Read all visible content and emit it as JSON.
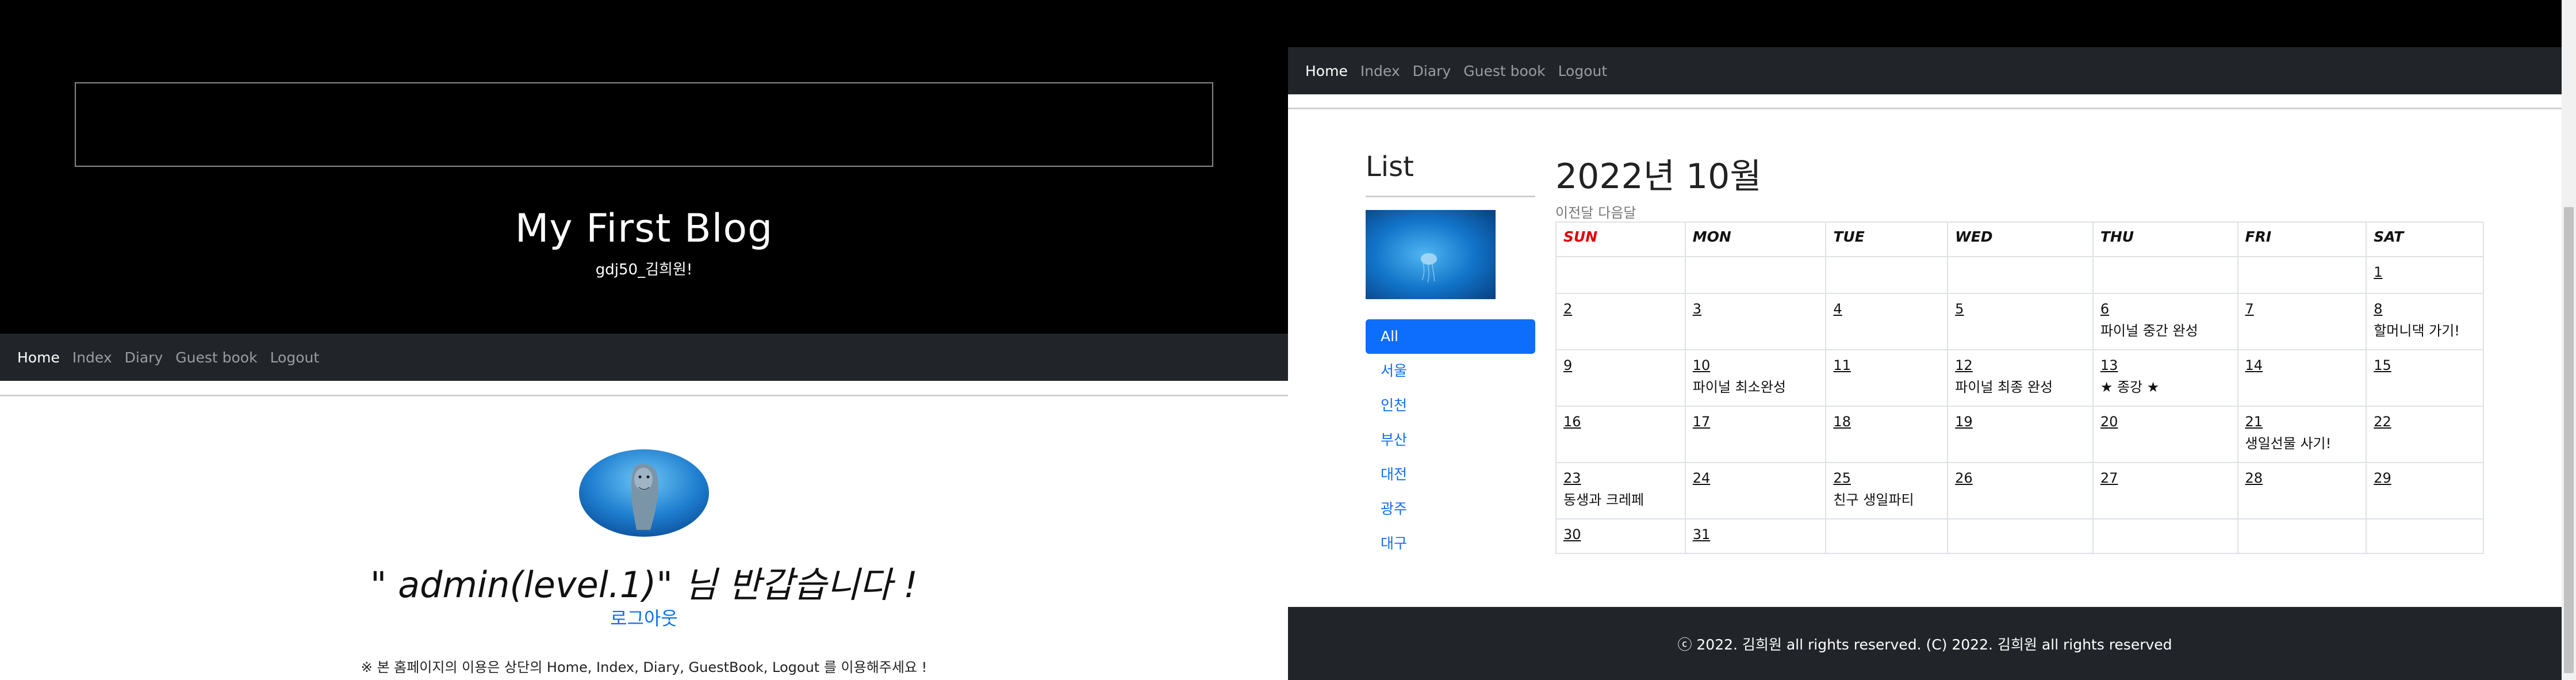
{
  "left": {
    "blog_title": "My First Blog",
    "blog_subtitle": "gdj50_김희원!",
    "nav": [
      "Home",
      "Index",
      "Diary",
      "Guest book",
      "Logout"
    ],
    "welcome": "\" admin(level.1)\" 님 반갑습니다 !",
    "logout_link": "로그아웃",
    "notice": "※ 본 홈페이지의 이용은 상단의 Home, Index, Diary, GuestBook, Logout 를 이용해주세요 !"
  },
  "right": {
    "nav": [
      "Home",
      "Index",
      "Diary",
      "Guest book",
      "Logout"
    ],
    "list_title": "List",
    "categories": [
      "All",
      "서울",
      "인천",
      "부산",
      "대전",
      "광주",
      "대구"
    ],
    "calendar_title": "2022년 10월",
    "prev_label": "이전달",
    "next_label": "다음달",
    "weekdays": [
      "SUN",
      "MON",
      "TUE",
      "WED",
      "THU",
      "FRI",
      "SAT"
    ],
    "weeks": [
      [
        {
          "d": "",
          "e": ""
        },
        {
          "d": "",
          "e": ""
        },
        {
          "d": "",
          "e": ""
        },
        {
          "d": "",
          "e": ""
        },
        {
          "d": "",
          "e": ""
        },
        {
          "d": "",
          "e": ""
        },
        {
          "d": "1",
          "e": ""
        }
      ],
      [
        {
          "d": "2",
          "e": ""
        },
        {
          "d": "3",
          "e": ""
        },
        {
          "d": "4",
          "e": ""
        },
        {
          "d": "5",
          "e": ""
        },
        {
          "d": "6",
          "e": "파이널 중간 완성"
        },
        {
          "d": "7",
          "e": ""
        },
        {
          "d": "8",
          "e": "할머니댁 가기!"
        }
      ],
      [
        {
          "d": "9",
          "e": ""
        },
        {
          "d": "10",
          "e": "파이널 최소완성"
        },
        {
          "d": "11",
          "e": ""
        },
        {
          "d": "12",
          "e": "파이널 최종 완성"
        },
        {
          "d": "13",
          "e": "★ 종강 ★"
        },
        {
          "d": "14",
          "e": ""
        },
        {
          "d": "15",
          "e": ""
        }
      ],
      [
        {
          "d": "16",
          "e": ""
        },
        {
          "d": "17",
          "e": ""
        },
        {
          "d": "18",
          "e": ""
        },
        {
          "d": "19",
          "e": ""
        },
        {
          "d": "20",
          "e": ""
        },
        {
          "d": "21",
          "e": "생일선물 사기!"
        },
        {
          "d": "22",
          "e": ""
        }
      ],
      [
        {
          "d": "23",
          "e": "동생과 크레페"
        },
        {
          "d": "24",
          "e": ""
        },
        {
          "d": "25",
          "e": "친구 생일파티"
        },
        {
          "d": "26",
          "e": ""
        },
        {
          "d": "27",
          "e": ""
        },
        {
          "d": "28",
          "e": ""
        },
        {
          "d": "29",
          "e": ""
        }
      ],
      [
        {
          "d": "30",
          "e": ""
        },
        {
          "d": "31",
          "e": ""
        },
        {
          "d": "",
          "e": ""
        },
        {
          "d": "",
          "e": ""
        },
        {
          "d": "",
          "e": ""
        },
        {
          "d": "",
          "e": ""
        },
        {
          "d": "",
          "e": ""
        }
      ]
    ],
    "footer": "ⓒ 2022. 김희원 all rights reserved. (C) 2022. 김희원 all rights reserved"
  },
  "colors": {
    "accent": "#0d6efd",
    "navbar": "#212529",
    "sunday": "#e0000a"
  }
}
